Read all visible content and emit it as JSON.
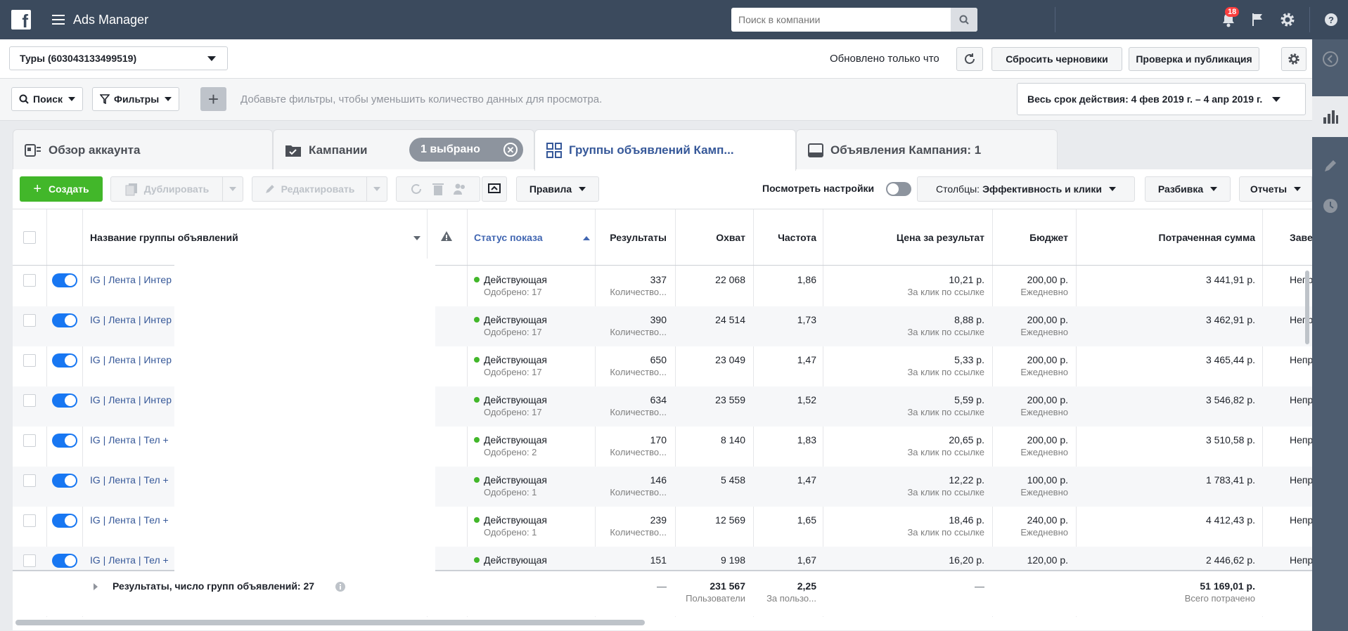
{
  "app": {
    "title": "Ads Manager"
  },
  "topbar": {
    "search_placeholder": "Поиск в компании",
    "notifications_count": "18"
  },
  "account": {
    "name": "Туры (603043133499519)",
    "updated": "Обновлено только что",
    "discard_label": "Сбросить черновики",
    "publish_label": "Проверка и публикация"
  },
  "filters": {
    "search_label": "Поиск",
    "filters_label": "Фильтры",
    "hint": "Добавьте фильтры, чтобы уменьшить количество данных для просмотра.",
    "date_range": "Весь срок действия: 4 фев 2019 г. – 4 апр 2019 г."
  },
  "tabs": [
    {
      "label": "Обзор аккаунта"
    },
    {
      "label": "Кампании"
    },
    {
      "label": "Группы объявлений Камп..."
    },
    {
      "label": "Объявления Кампания: 1"
    }
  ],
  "selected_pill": "1 выбрано",
  "toolbar": {
    "create": "Создать",
    "duplicate": "Дублировать",
    "edit": "Редактировать",
    "rules": "Правила",
    "view_settings": "Посмотреть настройки",
    "columns_prefix": "Столбцы:",
    "columns_value": "Эффективность и клики",
    "breakdown": "Разбивка",
    "reports": "Отчеты"
  },
  "columns": {
    "name": "Название группы объявлений",
    "status": "Статус показа",
    "results": "Результаты",
    "reach": "Охват",
    "frequency": "Частота",
    "cost": "Цена за результат",
    "budget": "Бюджет",
    "spent": "Потраченная сумма",
    "end": "Заве"
  },
  "rows": [
    {
      "name": "IG | Лента | Интер",
      "status": "Действующая",
      "approved": "Одобрено: 17",
      "results": "337",
      "results_sub": "Количество...",
      "reach": "22 068",
      "frequency": "1,86",
      "cost": "10,21 р.",
      "cost_sub": "За клик по ссылке",
      "budget": "200,00 р.",
      "budget_sub": "Ежедневно",
      "spent": "3 441,91 р.",
      "end": "Непр"
    },
    {
      "name": "IG | Лента | Интер",
      "status": "Действующая",
      "approved": "Одобрено: 17",
      "results": "390",
      "results_sub": "Количество...",
      "reach": "24 514",
      "frequency": "1,73",
      "cost": "8,88 р.",
      "cost_sub": "За клик по ссылке",
      "budget": "200,00 р.",
      "budget_sub": "Ежедневно",
      "spent": "3 462,91 р.",
      "end": "Непр"
    },
    {
      "name": "IG | Лента | Интер",
      "status": "Действующая",
      "approved": "Одобрено: 17",
      "results": "650",
      "results_sub": "Количество...",
      "reach": "23 049",
      "frequency": "1,47",
      "cost": "5,33 р.",
      "cost_sub": "За клик по ссылке",
      "budget": "200,00 р.",
      "budget_sub": "Ежедневно",
      "spent": "3 465,44 р.",
      "end": "Непр"
    },
    {
      "name": "IG | Лента | Интер",
      "status": "Действующая",
      "approved": "Одобрено: 17",
      "results": "634",
      "results_sub": "Количество...",
      "reach": "23 559",
      "frequency": "1,52",
      "cost": "5,59 р.",
      "cost_sub": "За клик по ссылке",
      "budget": "200,00 р.",
      "budget_sub": "Ежедневно",
      "spent": "3 546,82 р.",
      "end": "Непр"
    },
    {
      "name": "IG | Лента | Тел +",
      "status": "Действующая",
      "approved": "Одобрено: 2",
      "results": "170",
      "results_sub": "Количество...",
      "reach": "8 140",
      "frequency": "1,83",
      "cost": "20,65 р.",
      "cost_sub": "За клик по ссылке",
      "budget": "200,00 р.",
      "budget_sub": "Ежедневно",
      "spent": "3 510,58 р.",
      "end": "Непр"
    },
    {
      "name": "IG | Лента | Тел +",
      "status": "Действующая",
      "approved": "Одобрено: 1",
      "results": "146",
      "results_sub": "Количество...",
      "reach": "5 458",
      "frequency": "1,47",
      "cost": "12,22 р.",
      "cost_sub": "За клик по ссылке",
      "budget": "100,00 р.",
      "budget_sub": "Ежедневно",
      "spent": "1 783,41 р.",
      "end": "Непр"
    },
    {
      "name": "IG | Лента | Тел +",
      "status": "Действующая",
      "approved": "Одобрено: 1",
      "results": "239",
      "results_sub": "Количество...",
      "reach": "12 569",
      "frequency": "1,65",
      "cost": "18,46 р.",
      "cost_sub": "За клик по ссылке",
      "budget": "240,00 р.",
      "budget_sub": "Ежедневно",
      "spent": "4 412,43 р.",
      "end": "Непр"
    },
    {
      "name": "IG | Лента | Тел +",
      "status": "Действующая",
      "approved": "",
      "results": "151",
      "results_sub": "",
      "reach": "9 198",
      "frequency": "1,67",
      "cost": "16,20 р.",
      "cost_sub": "",
      "budget": "120,00 р.",
      "budget_sub": "",
      "spent": "2 446,62 р.",
      "end": "Непр"
    }
  ],
  "footer": {
    "label": "Результаты, число групп объявлений: 27",
    "results": "—",
    "reach": "231 567",
    "reach_sub": "Пользователи",
    "frequency": "2,25",
    "frequency_sub": "За пользо...",
    "cost": "—",
    "spent": "51 169,01 р.",
    "spent_sub": "Всего потрачено"
  },
  "colors": {
    "topbar": "#3b4a5d",
    "accent": "#365899",
    "create": "#42b72a",
    "toggle_on": "#1877f2"
  }
}
